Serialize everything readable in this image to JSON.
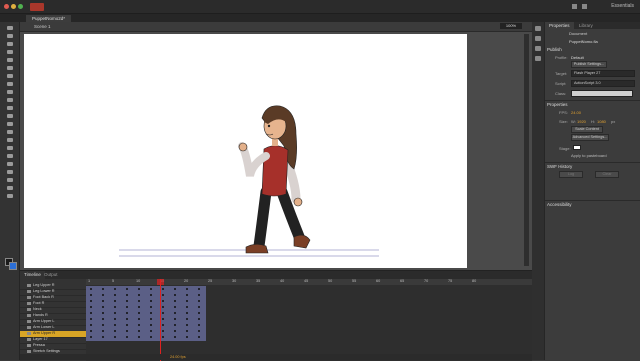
{
  "app": {
    "workspace_label": "Essentials"
  },
  "document": {
    "tab_label": "PuppetNomo2d*",
    "scene_label": "Scene 1",
    "zoom": "100%"
  },
  "properties_panel": {
    "tabs": [
      "Properties",
      "Library"
    ],
    "doc_type": "Document",
    "doc_name": "PuppetNomo.fla",
    "publish_section": "Publish",
    "profile_label": "Profile:",
    "profile_value": "Default",
    "publish_settings_button": "Publish Settings...",
    "target_label": "Target:",
    "target_value": "Flash Player 27",
    "script_label": "Script:",
    "script_value": "ActionScript 3.0",
    "class_label": "Class:",
    "properties_section": "Properties",
    "fps_label": "FPS:",
    "fps_value": "24.00",
    "size_label": "Size:",
    "w_label": "W:",
    "w_value": "1920",
    "h_label": "H:",
    "h_value": "1080",
    "px_label": "px",
    "scale_button": "Scale Content",
    "advanced_button": "Advanced Settings...",
    "stage_label": "Stage:",
    "stage_color": "#ffffff",
    "apply_label": "Apply to pasteboard",
    "swf_section": "SWF History",
    "log_button": "Log",
    "clear_button": "Clear",
    "accessibility_section": "Accessibility"
  },
  "timeline": {
    "tabs": [
      "Timeline",
      "Output"
    ],
    "layers": [
      "Leg Upper R",
      "Leg Lower R",
      "Foot Back R",
      "Foot R",
      "Neck",
      "Hands R",
      "Arm Upper L",
      "Arm Lower L",
      "Arm Upper R",
      "Layer 17",
      "Pressa",
      "Stretch Settings"
    ],
    "selected_layer_index": 8,
    "frame_numbers": [
      "1",
      "5",
      "10",
      "15",
      "20",
      "25",
      "30",
      "35",
      "40",
      "45",
      "50",
      "55",
      "60",
      "65",
      "70",
      "75",
      "80"
    ],
    "status": "24.00 fps"
  },
  "colors": {
    "accent": "#d8a526",
    "playhead": "#dd2222",
    "tween_span": "#5b5f86",
    "fill_swatch": "#2c6fd6"
  }
}
